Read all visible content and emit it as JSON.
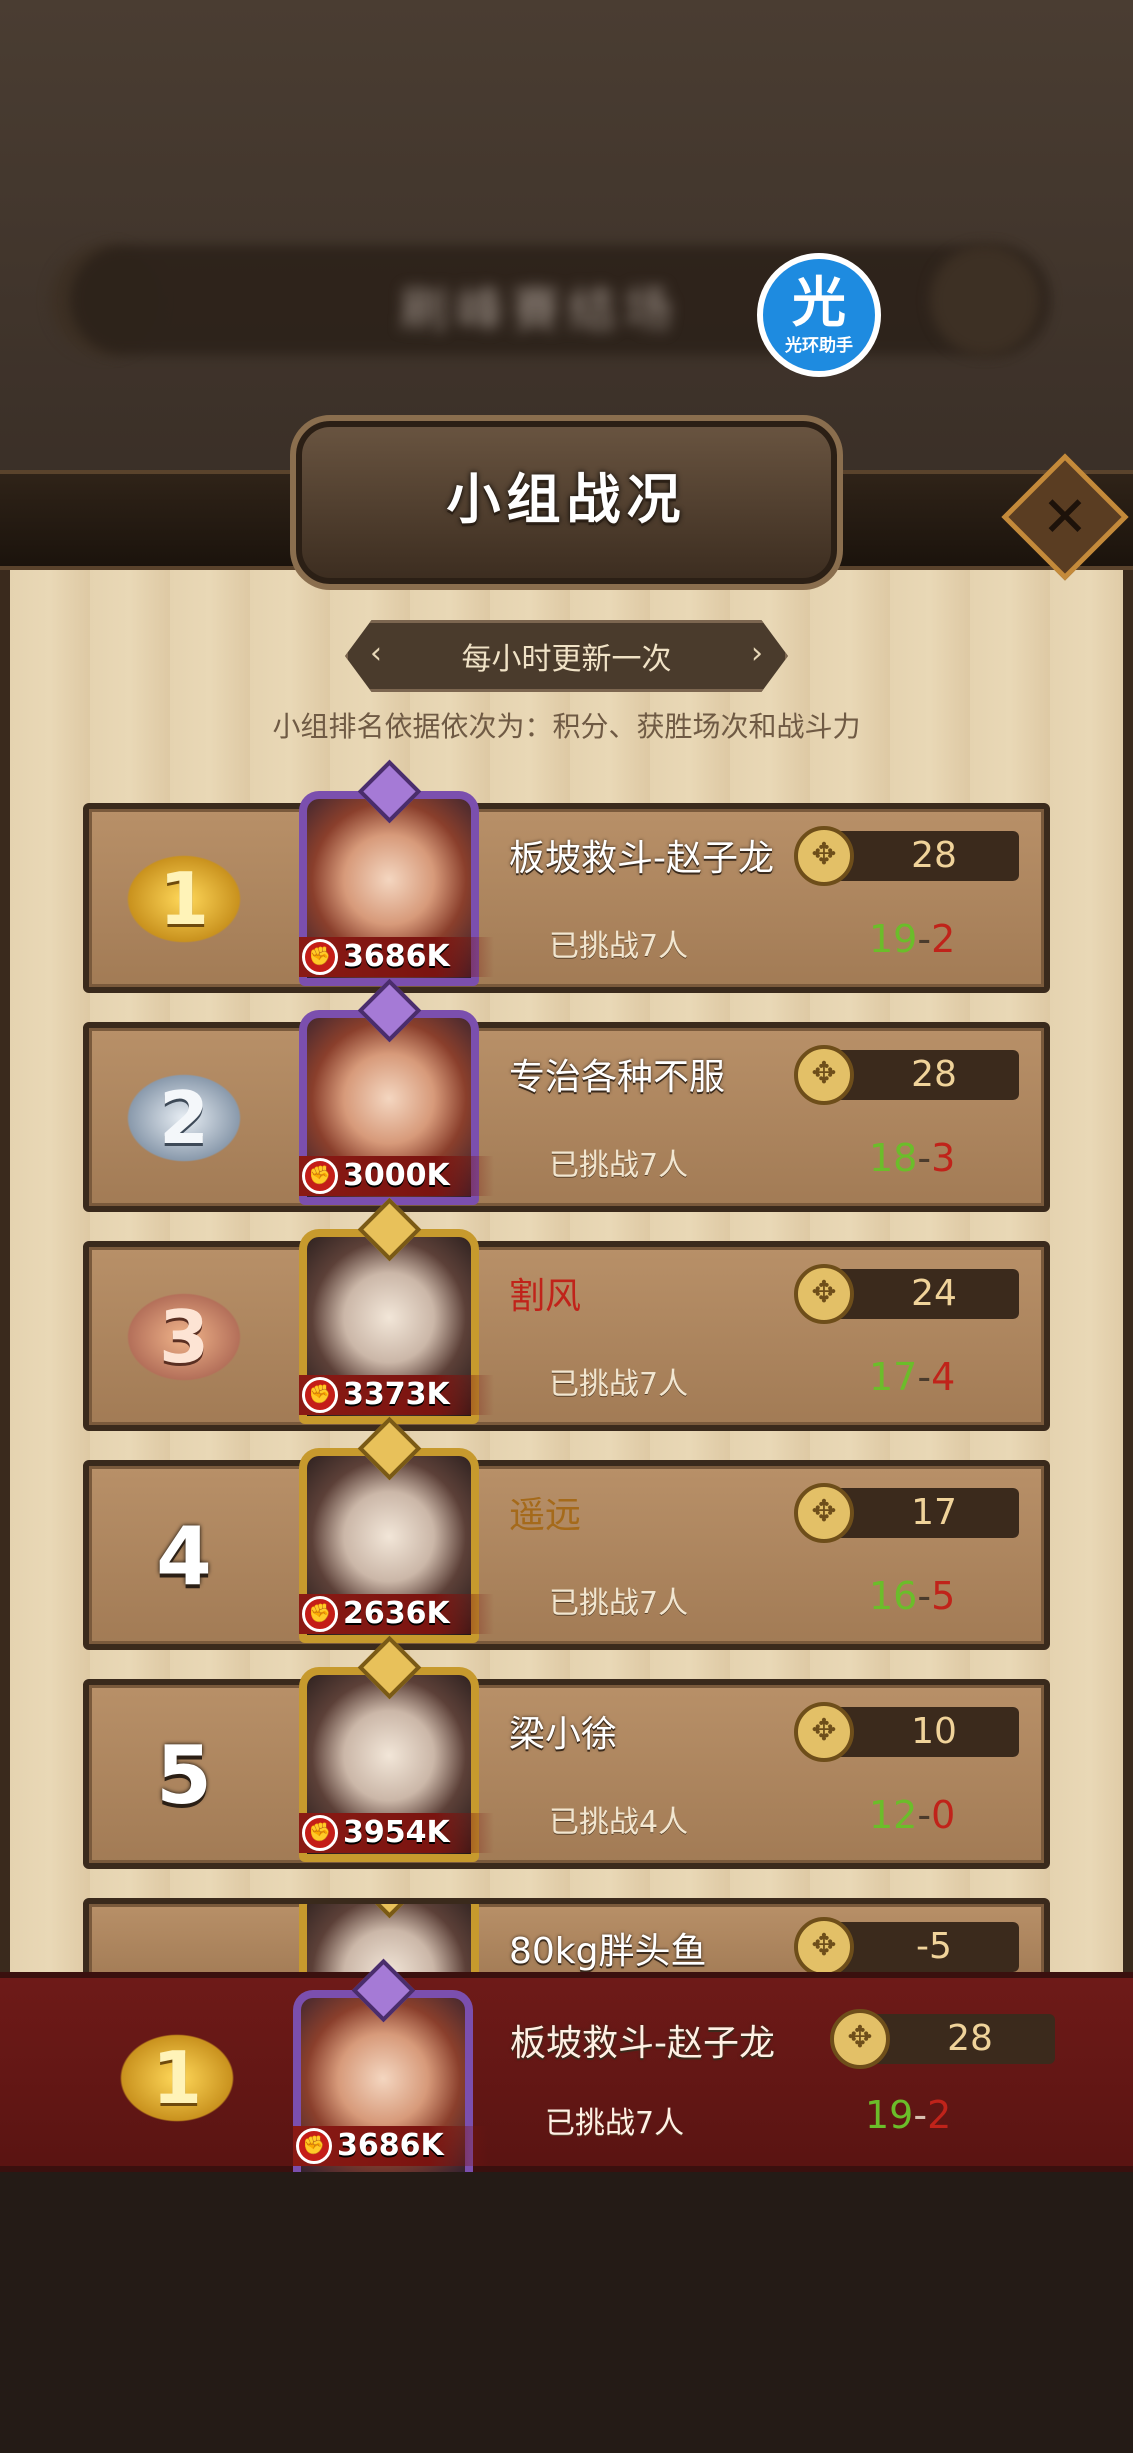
{
  "background": {
    "blurred_banner_text": "刷峰賽结场"
  },
  "watermark": {
    "big": "光",
    "small": "光环助手"
  },
  "header": {
    "title": "小组战况",
    "close_symbol": "✕"
  },
  "info": {
    "update_text": "每小时更新一次",
    "rank_note": "小组排名依据依次为：积分、获胜场次和战斗力"
  },
  "rows": [
    {
      "rank": "1",
      "medal": "gold",
      "name": "板坡救斗-赵子龙",
      "name_color": "white",
      "power": "3686K",
      "challenged": "已挑战7人",
      "score": "28",
      "wins": "19",
      "losses": "2"
    },
    {
      "rank": "2",
      "medal": "silver",
      "name": "专治各种不服",
      "name_color": "white",
      "power": "3000K",
      "challenged": "已挑战7人",
      "score": "28",
      "wins": "18",
      "losses": "3"
    },
    {
      "rank": "3",
      "medal": "bronze",
      "name": "割风",
      "name_color": "red",
      "power": "3373K",
      "challenged": "已挑战7人",
      "score": "24",
      "wins": "17",
      "losses": "4"
    },
    {
      "rank": "4",
      "medal": "plain",
      "name": "遥远",
      "name_color": "gold",
      "power": "2636K",
      "challenged": "已挑战7人",
      "score": "17",
      "wins": "16",
      "losses": "5"
    },
    {
      "rank": "5",
      "medal": "plain",
      "name": "梁小徐",
      "name_color": "white",
      "power": "3954K",
      "challenged": "已挑战4人",
      "score": "10",
      "wins": "12",
      "losses": "0"
    },
    {
      "rank": "",
      "medal": "plain",
      "name": "80kg胖头鱼",
      "name_color": "white",
      "power": "",
      "challenged": "",
      "score": "-5",
      "wins": "",
      "losses": ""
    }
  ],
  "own": {
    "rank": "1",
    "medal": "gold",
    "name": "板坡救斗-赵子龙",
    "power": "3686K",
    "challenged": "已挑战7人",
    "score": "28",
    "wins": "19",
    "losses": "2"
  },
  "record_separator": "-",
  "icons": {
    "score": "knot-emblem-icon",
    "power": "fist-icon",
    "close": "close-icon"
  }
}
